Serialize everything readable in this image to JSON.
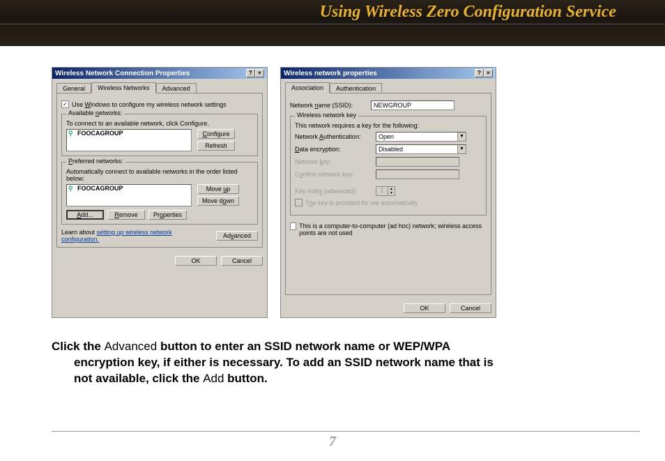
{
  "page": {
    "title": "Using Wireless Zero Configuration Service",
    "number": "7"
  },
  "instruction": {
    "pre1": "Click the ",
    "adv": "Advanced",
    "mid1": " button to enter an SSID network name or WEP/WPA ",
    "line2a": "encryption key, if either is necessary.  To add an SSID network name that is ",
    "line3a": "not available, click the ",
    "add": "Add",
    "line3b": " button."
  },
  "dlg1": {
    "title": "Wireless Network Connection Properties",
    "help_btn": "?",
    "close_btn": "×",
    "tabs": {
      "general": "General",
      "wireless": "Wireless Networks",
      "advanced": "Advanced"
    },
    "use_windows": "Use Windows to configure my wireless network settings",
    "checked": "✓",
    "avail": {
      "legend": "Available networks:",
      "hint": "To connect to an available network, click Configure.",
      "item": "FOOCAGROUP",
      "configure": "Configure",
      "refresh": "Refresh"
    },
    "pref": {
      "legend": "Preferred networks:",
      "hint": "Automatically connect to available networks in the order listed below:",
      "item": "FOOCAGROUP",
      "moveup": "Move up",
      "movedown": "Move down",
      "add": "Add...",
      "remove": "Remove",
      "properties": "Properties"
    },
    "learn_pre": "Learn about ",
    "learn_link": "setting up wireless network configuration.",
    "advanced_btn": "Advanced",
    "ok": "OK",
    "cancel": "Cancel"
  },
  "dlg2": {
    "title": "Wireless network properties",
    "help_btn": "?",
    "close_btn": "×",
    "tabs": {
      "assoc": "Association",
      "auth": "Authentication"
    },
    "ssid_label": "Network name (SSID):",
    "ssid_value": "NEWGROUP",
    "key": {
      "legend": "Wireless network key",
      "hint": "This network requires a key for the following:",
      "auth_label": "Network Authentication:",
      "auth_value": "Open",
      "enc_label": "Data encryption:",
      "enc_value": "Disabled",
      "netkey_label": "Network key:",
      "confirm_label": "Confirm network key:",
      "index_label": "Key index (advanced):",
      "index_value": "1",
      "autokey": "The key is provided for me automatically"
    },
    "adhoc": "This is a computer-to-computer (ad hoc) network; wireless access points are not used",
    "ok": "OK",
    "cancel": "Cancel"
  }
}
